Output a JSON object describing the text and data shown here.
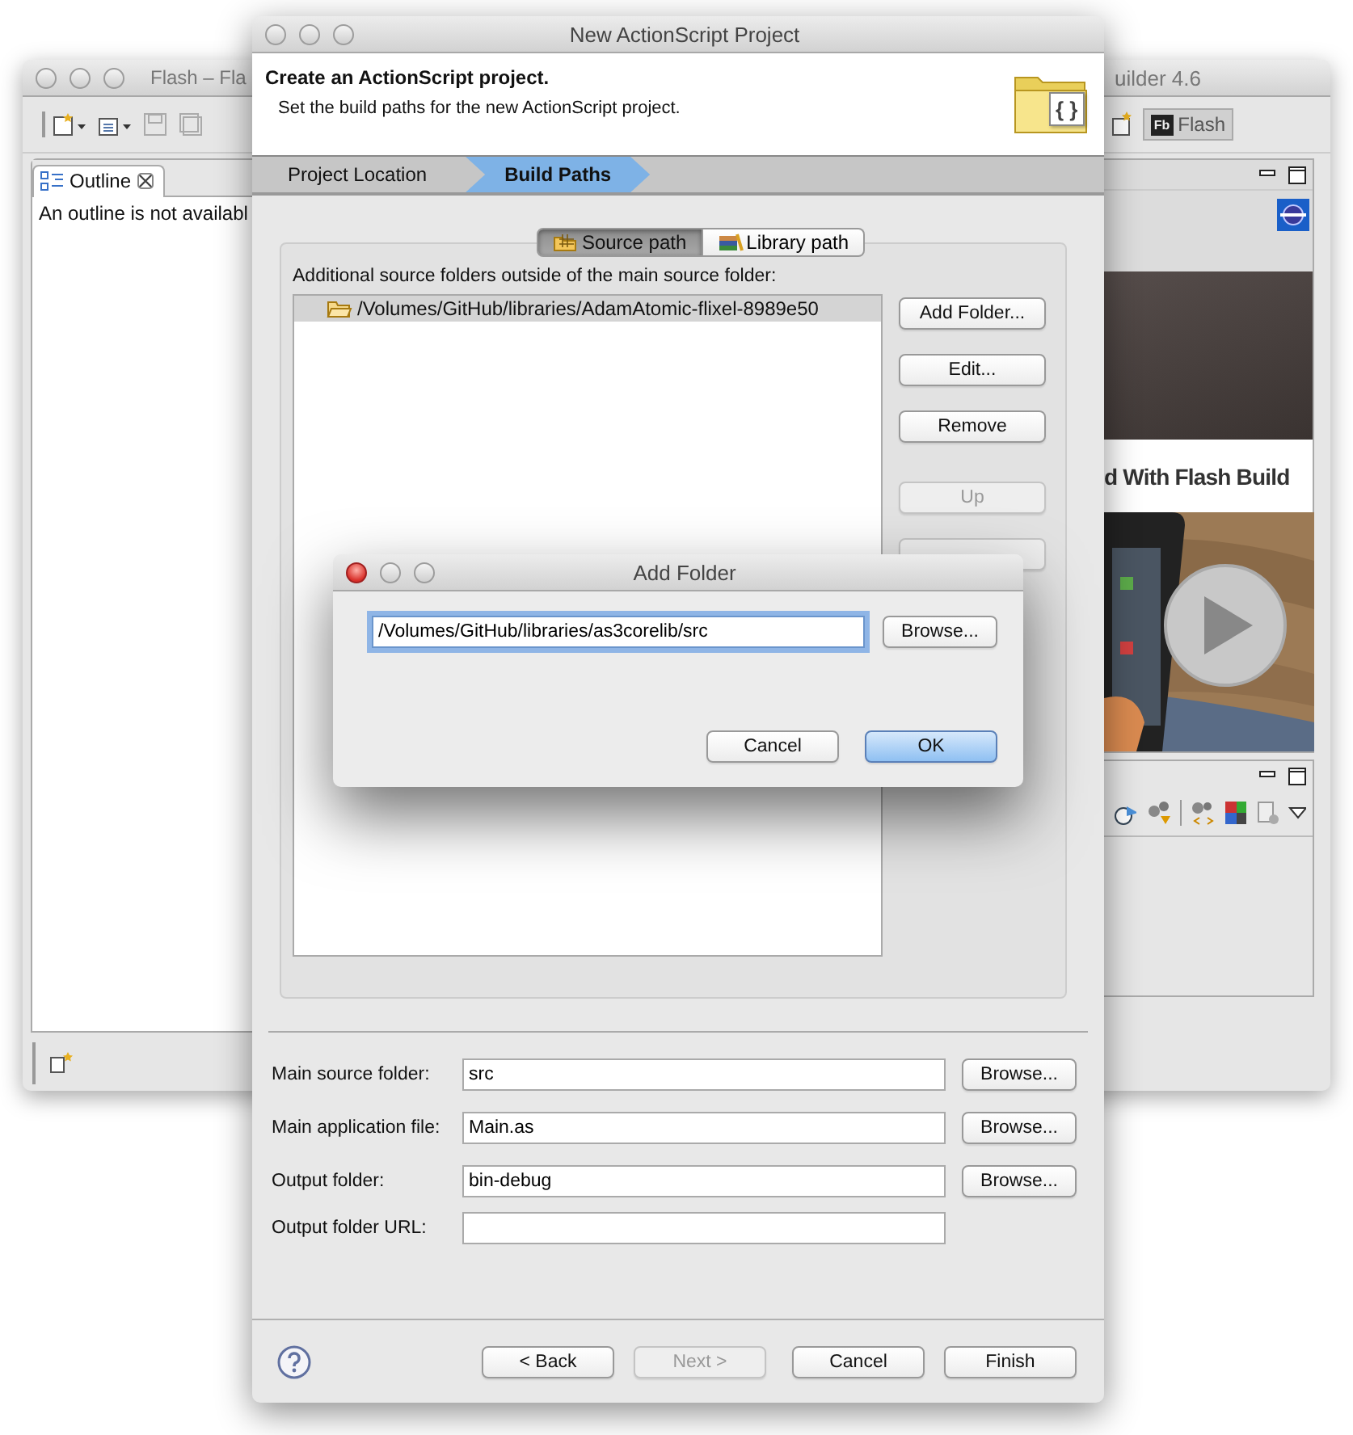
{
  "background_window": {
    "active": false,
    "title_left": "Flash – Fla",
    "title_right": "uilder 4.6",
    "perspective": {
      "icon_text": "Fb",
      "label": "Flash"
    },
    "outline": {
      "tab": "Outline",
      "message": "An outline is not availabl"
    },
    "welcome": {
      "heading": "d With Flash Build"
    }
  },
  "dialog": {
    "active": false,
    "title": "New ActionScript Project",
    "header": {
      "title": "Create an ActionScript project.",
      "subtitle": "Set the build paths for the new ActionScript project.",
      "badge_text": "{ }"
    },
    "steps": [
      {
        "label": "Project Location",
        "selected": false
      },
      {
        "label": "Build Paths",
        "selected": true
      }
    ],
    "tabs": [
      {
        "label": "Source path",
        "selected": true
      },
      {
        "label": "Library path",
        "selected": false
      }
    ],
    "list_label": "Additional source folders outside of the main source folder:",
    "folders": [
      {
        "path": "/Volumes/GitHub/libraries/AdamAtomic-flixel-8989e50",
        "selected": true
      }
    ],
    "side_buttons": [
      {
        "label": "Add Folder...",
        "disabled": false
      },
      {
        "label": "Edit...",
        "disabled": false
      },
      {
        "label": "Remove",
        "disabled": false
      },
      {
        "label": "Up",
        "disabled": true
      }
    ],
    "fields": [
      {
        "label": "Main source folder:",
        "value": "src",
        "button": "Browse..."
      },
      {
        "label": "Main application file:",
        "value": "Main.as",
        "button": "Browse..."
      },
      {
        "label": "Output folder:",
        "value": "bin-debug",
        "button": "Browse..."
      },
      {
        "label": "Output folder URL:"
      }
    ],
    "footer_buttons": [
      {
        "label": "< Back",
        "disabled": false
      },
      {
        "label": "Next >",
        "disabled": true
      },
      {
        "label": "Cancel",
        "disabled": false
      },
      {
        "label": "Finish",
        "disabled": false
      }
    ]
  },
  "add_folder": {
    "active": true,
    "title": "Add Folder",
    "value": "/Volumes/GitHub/libraries/as3corelib/src",
    "focused": true,
    "browse": "Browse...",
    "buttons": [
      {
        "label": "Cancel",
        "default": false
      },
      {
        "label": "OK",
        "default": true
      }
    ]
  }
}
